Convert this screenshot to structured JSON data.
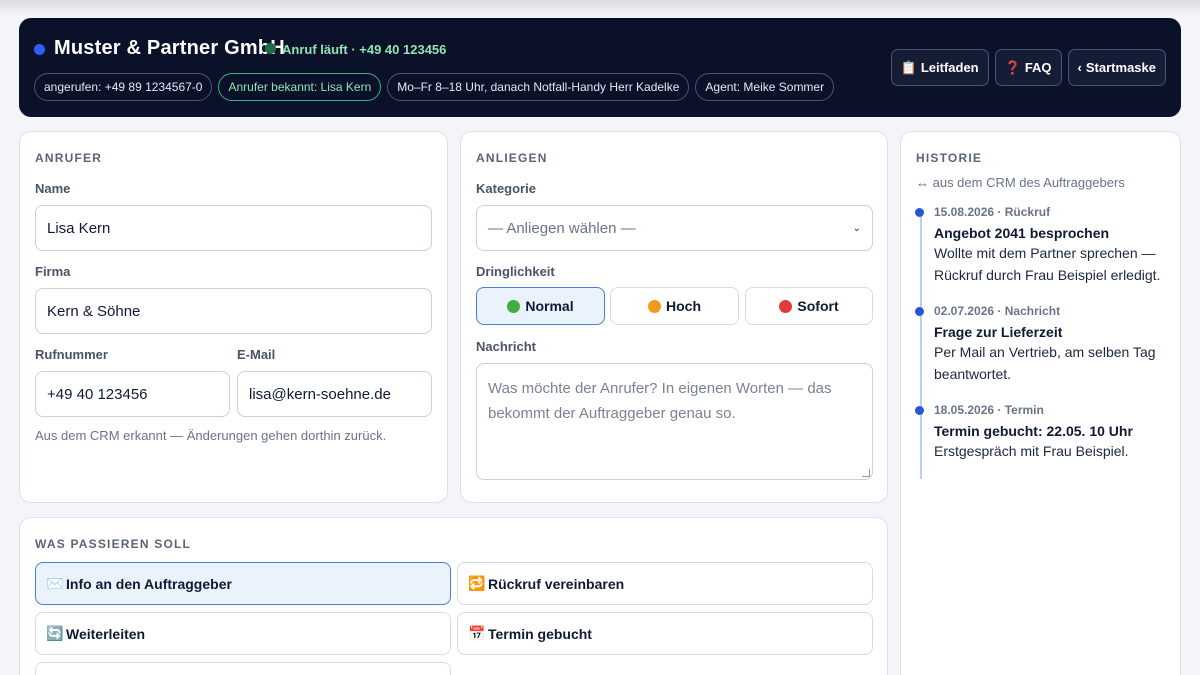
{
  "header": {
    "company": "Muster & Partner GmbH",
    "call_status": "Anruf läuft · +49 40 123456",
    "chips": [
      "angerufen: +49 89 1234567-0",
      "Anrufer bekannt: Lisa Kern",
      "Mo–Fr 8–18 Uhr, danach Notfall-Handy Herr Kadelke",
      "Agent: Meike Sommer"
    ],
    "buttons": {
      "guide": "Leitfaden",
      "faq": "FAQ",
      "home": "Startmaske"
    }
  },
  "caller": {
    "section": "ANRUFER",
    "name_label": "Name",
    "name_value": "Lisa Kern",
    "company_label": "Firma",
    "company_value": "Kern & Söhne",
    "phone_label": "Rufnummer",
    "phone_value": "+49 40 123456",
    "email_label": "E-Mail",
    "email_value": "lisa@kern-soehne.de",
    "hint": "Aus dem CRM erkannt — Änderungen gehen dorthin zurück."
  },
  "concern": {
    "section": "ANLIEGEN",
    "category_label": "Kategorie",
    "category_value": "— Anliegen wählen —",
    "urgency_label": "Dringlichkeit",
    "urgency": [
      "Normal",
      "Hoch",
      "Sofort"
    ],
    "urgency_selected": "Normal",
    "message_label": "Nachricht",
    "message_placeholder": "Was möchte der Anrufer? In eigenen Worten — das bekommt der Auftraggeber genau so."
  },
  "actions": {
    "section": "WAS PASSIEREN SOLL",
    "items": [
      "Info an den Auftraggeber",
      "Rückruf vereinbaren",
      "Weiterleiten",
      "Termin gebucht"
    ],
    "selected": "Info an den Auftraggeber"
  },
  "history": {
    "section": "HISTORIE",
    "subtitle": "↔ aus dem CRM des Auftraggebers",
    "items": [
      {
        "meta": "15.08.2026 · Rückruf",
        "title": "Angebot 2041 besprochen",
        "text": "Wollte mit dem Partner sprechen — Rückruf durch Frau Beispiel erledigt."
      },
      {
        "meta": "02.07.2026 · Nachricht",
        "title": "Frage zur Lieferzeit",
        "text": "Per Mail an Vertrieb, am selben Tag beantwortet."
      },
      {
        "meta": "18.05.2026 · Termin",
        "title": "Termin gebucht: 22.05. 10 Uhr",
        "text": "Erstgespräch mit Frau Beispiel."
      }
    ]
  },
  "colors": {
    "header_bg": "#0a1128",
    "accent": "#2356d8",
    "active_bg": "#eaf2fc",
    "call_green": "#8fe3b4",
    "urgency_normal": "#3fae3f",
    "urgency_high": "#f39a1e",
    "urgency_immediate": "#e23b3b"
  }
}
